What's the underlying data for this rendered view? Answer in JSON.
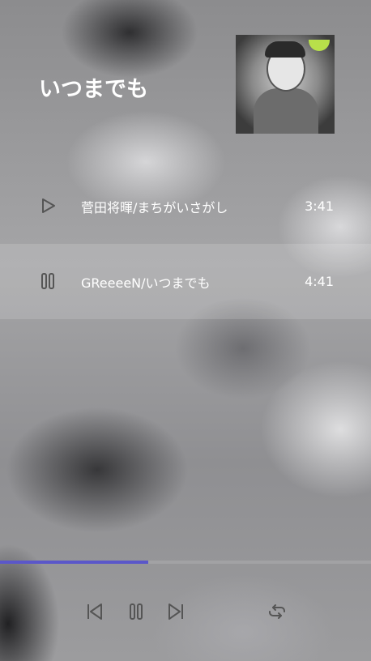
{
  "now_playing": {
    "title": "いつまでも",
    "progress_fraction": 0.4
  },
  "tracks": [
    {
      "name": "菅田将暉/まちがいさがし",
      "duration": "3:41",
      "state_icon": "play-icon"
    },
    {
      "name": "GReeeeN/いつまでも",
      "duration": "4:41",
      "state_icon": "pause-icon"
    }
  ],
  "controls": {
    "icons": [
      "skip-previous-icon",
      "pause-icon",
      "skip-next-icon",
      "repeat-icon"
    ]
  },
  "colors": {
    "accent": "#5b57c9",
    "icon": "#555555",
    "text": "#ffffff"
  }
}
